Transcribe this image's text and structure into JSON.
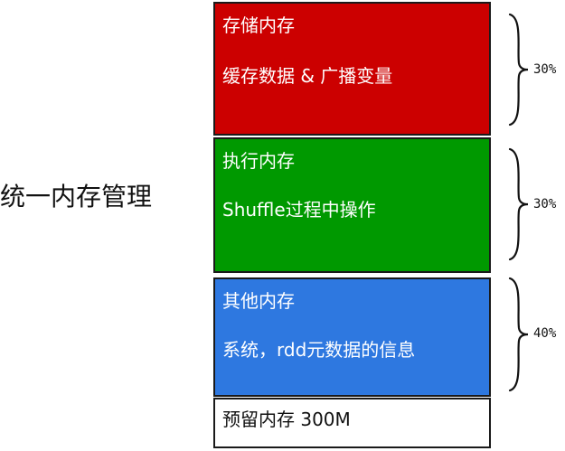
{
  "diagram": {
    "title": "统一内存管理",
    "blocks": [
      {
        "title": "存储内存",
        "description": "缓存数据 & 广播变量",
        "color": "#cc0000",
        "share": "30%"
      },
      {
        "title": "执行内存",
        "description": "Shuffle过程中操作",
        "color": "#009900",
        "share": "30%"
      },
      {
        "title": "其他内存",
        "description": "系统，rdd元数据的信息",
        "color": "#2e78e0",
        "share": "40%"
      },
      {
        "title": "预留内存 300M",
        "color": "#ffffff"
      }
    ]
  }
}
